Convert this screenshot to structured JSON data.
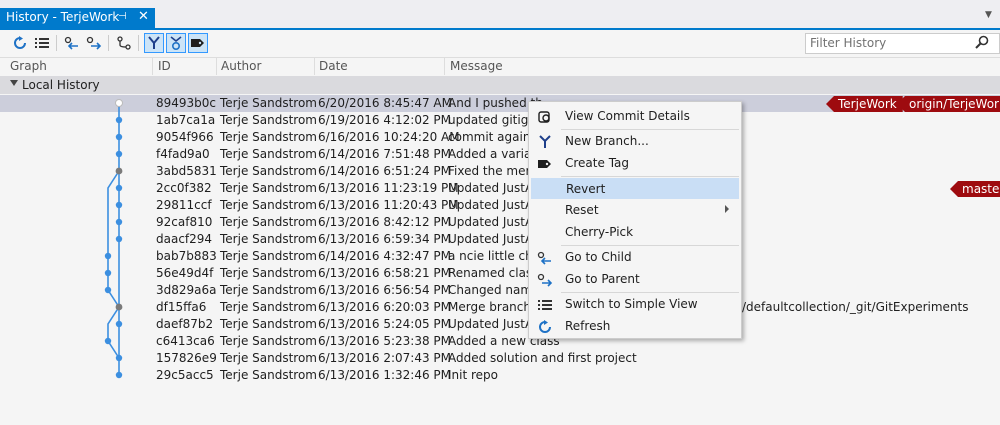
{
  "tab": {
    "title": "History - TerjeWork",
    "pin": "⊣",
    "close": "✕"
  },
  "toolbar": {
    "filter_placeholder": "Filter History",
    "buttons": [
      "refresh-icon",
      "list-view-icon",
      "go-to-child-icon",
      "go-to-parent-icon",
      "branch-graph-icon",
      "show-merges-icon",
      "show-remote-icon",
      "tag-icon"
    ]
  },
  "columns": {
    "graph": "Graph",
    "id": "ID",
    "author": "Author",
    "date": "Date",
    "message": "Message"
  },
  "group": {
    "label": "Local History"
  },
  "commits": [
    {
      "id": "89493b0c",
      "author": "Terje Sandstrom",
      "date": "6/20/2016 8:45:47 AM",
      "message": "And I pushed th"
    },
    {
      "id": "1ab7ca1a",
      "author": "Terje Sandstrom",
      "date": "6/19/2016 4:12:02 PM",
      "message": "updated gitign"
    },
    {
      "id": "9054f966",
      "author": "Terje Sandstrom",
      "date": "6/16/2016 10:24:20 AM",
      "message": "commit again"
    },
    {
      "id": "f4fad9a0",
      "author": "Terje Sandstrom",
      "date": "6/14/2016 7:51:48 PM",
      "message": "Added a variab"
    },
    {
      "id": "3abd5831",
      "author": "Terje Sandstrom",
      "date": "6/14/2016 6:51:24 PM",
      "message": "Fixed the merg"
    },
    {
      "id": "2cc0f382",
      "author": "Terje Sandstrom",
      "date": "6/13/2016 11:23:19 PM",
      "message": "Updated JustAC"
    },
    {
      "id": "29811ccf",
      "author": "Terje Sandstrom",
      "date": "6/13/2016 11:20:43 PM",
      "message": "Updated JustAC"
    },
    {
      "id": "92caf810",
      "author": "Terje Sandstrom",
      "date": "6/13/2016 8:42:12 PM",
      "message": "Updated JustAC"
    },
    {
      "id": "daacf294",
      "author": "Terje Sandstrom",
      "date": "6/13/2016 6:59:34 PM",
      "message": "Updated JustAC"
    },
    {
      "id": "bab7b883",
      "author": "Terje Sandstrom",
      "date": "6/14/2016 4:32:47 PM",
      "message": "a ncie little cha"
    },
    {
      "id": "56e49d4f",
      "author": "Terje Sandstrom",
      "date": "6/13/2016 6:58:21 PM",
      "message": "Renamed class"
    },
    {
      "id": "3d829a6a",
      "author": "Terje Sandstrom",
      "date": "6/13/2016 6:56:54 PM",
      "message": "Changed name"
    },
    {
      "id": "df15ffa6",
      "author": "Terje Sandstrom",
      "date": "6/13/2016 6:20:03 PM",
      "message": "Merge branch '",
      "message_tail": "/defaultcollection/_git/GitExperiments"
    },
    {
      "id": "daef87b2",
      "author": "Terje Sandstrom",
      "date": "6/13/2016 5:24:05 PM",
      "message": "Updated JustAC"
    },
    {
      "id": "c6413ca6",
      "author": "Terje Sandstrom",
      "date": "6/13/2016 5:23:38 PM",
      "message": "Added a new class"
    },
    {
      "id": "157826e9",
      "author": "Terje Sandstrom",
      "date": "6/13/2016 2:07:43 PM",
      "message": "Added solution and first project"
    },
    {
      "id": "29c5acc5",
      "author": "Terje Sandstrom",
      "date": "6/13/2016 1:32:46 PM",
      "message": "Init repo"
    }
  ],
  "badges": {
    "row0": [
      "TerjeWork",
      "origin/TerjeWork"
    ],
    "row5": [
      "master"
    ]
  },
  "context_menu": {
    "items": [
      {
        "label": "View Commit Details",
        "icon": "commit-details-icon"
      },
      {
        "label": "New Branch...",
        "icon": "new-branch-icon"
      },
      {
        "label": "Create Tag",
        "icon": "tag-icon"
      },
      {
        "label": "Revert",
        "icon": ""
      },
      {
        "label": "Reset",
        "icon": ""
      },
      {
        "label": "Cherry-Pick",
        "icon": ""
      },
      {
        "label": "Go to Child",
        "icon": "go-to-child-icon"
      },
      {
        "label": "Go to Parent",
        "icon": "go-to-parent-icon"
      },
      {
        "label": "Switch to Simple View",
        "icon": "list-view-icon"
      },
      {
        "label": "Refresh",
        "icon": "refresh-icon"
      }
    ]
  },
  "colors": {
    "accent": "#007acc",
    "badge": "#9e0b0f",
    "graph_line": "#3c8fe0",
    "selected_row": "#cccedb",
    "menu_highlight": "#c9def5"
  }
}
